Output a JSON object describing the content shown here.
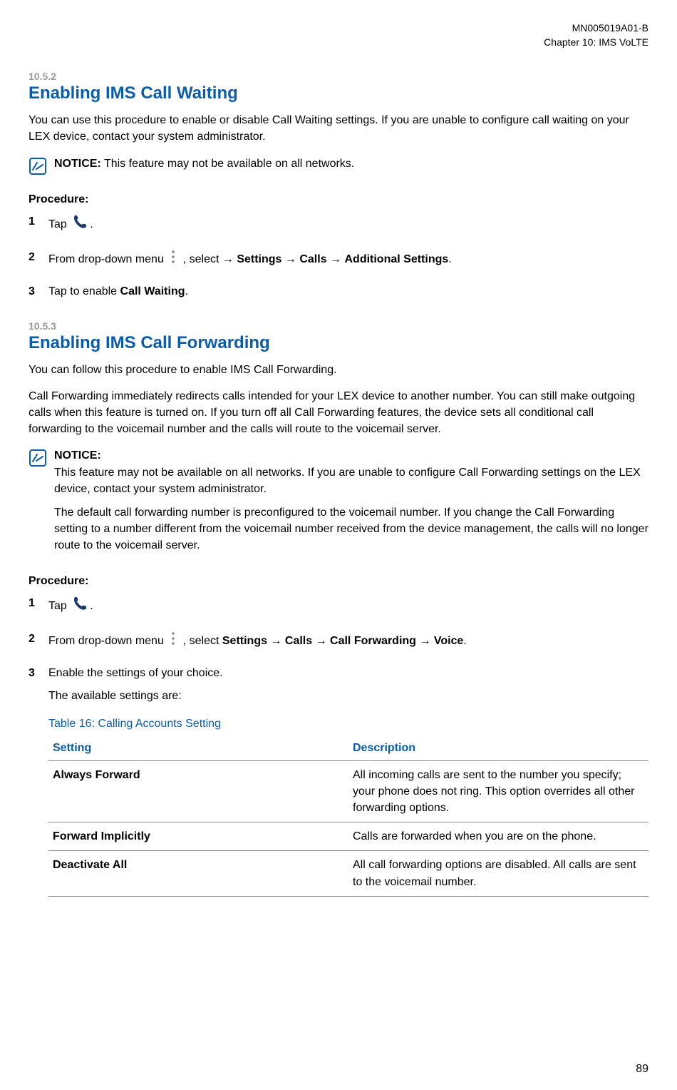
{
  "header": {
    "doc_id": "MN005019A01-B",
    "chapter": "Chapter 10:  IMS VoLTE"
  },
  "s1": {
    "num": "10.5.2",
    "title": "Enabling IMS Call Waiting",
    "intro": "You can use this procedure to enable or disable Call Waiting settings. If you are unable to configure call waiting on your LEX device, contact your system administrator.",
    "notice_label": "NOTICE:",
    "notice_text": " This feature may not be available on all networks.",
    "procedure_label": "Procedure:",
    "step1_a": "Tap ",
    "step1_b": ".",
    "step2_a": "From drop-down menu ",
    "step2_b": " , select → ",
    "step2_path1": "Settings",
    "step2_arrow": " → ",
    "step2_path2": "Calls",
    "step2_path3": "Additional Settings",
    "step2_c": ".",
    "step3_a": "Tap to enable ",
    "step3_b": "Call Waiting",
    "step3_c": "."
  },
  "s2": {
    "num": "10.5.3",
    "title": "Enabling IMS Call Forwarding",
    "intro1": "You can follow this procedure to enable IMS Call Forwarding.",
    "intro2": "Call Forwarding immediately redirects calls intended for your LEX device to another number. You can still make outgoing calls when this feature is turned on. If you turn off all Call Forwarding features, the device sets all conditional call forwarding to the voicemail number and the calls will route to the voicemail server.",
    "notice_label": "NOTICE:",
    "notice_p1": "This feature may not be available on all networks. If you are unable to configure Call Forwarding settings on the LEX device, contact your system administrator.",
    "notice_p2": "The default call forwarding number is preconfigured to the voicemail number. If you change the Call Forwarding setting to a number different from the voicemail number received from the device management, the calls will no longer route to the voicemail server.",
    "procedure_label": "Procedure:",
    "step1_a": "Tap ",
    "step1_b": ".",
    "step2_a": "From drop-down menu ",
    "step2_b": " , select ",
    "step2_path1": "Settings",
    "step2_arrow": " → ",
    "step2_path2": "Calls",
    "step2_path3": "Call Forwarding",
    "step2_path4": "Voice",
    "step2_c": ".",
    "step3": "Enable the settings of your choice.",
    "step3_sub": "The available settings are:"
  },
  "table": {
    "caption": "Table 16: Calling Accounts Setting",
    "h1": "Setting",
    "h2": "Description",
    "rows": [
      {
        "setting": "Always Forward",
        "desc": "All incoming calls are sent to the number you specify; your phone does not ring. This option overrides all other forwarding options."
      },
      {
        "setting": "Forward Implicitly",
        "desc": "Calls are forwarded when you are on the phone."
      },
      {
        "setting": "Deactivate All",
        "desc": "All call forwarding options are disabled. All calls are sent to the voicemail num­ber."
      }
    ]
  },
  "page_number": "89"
}
